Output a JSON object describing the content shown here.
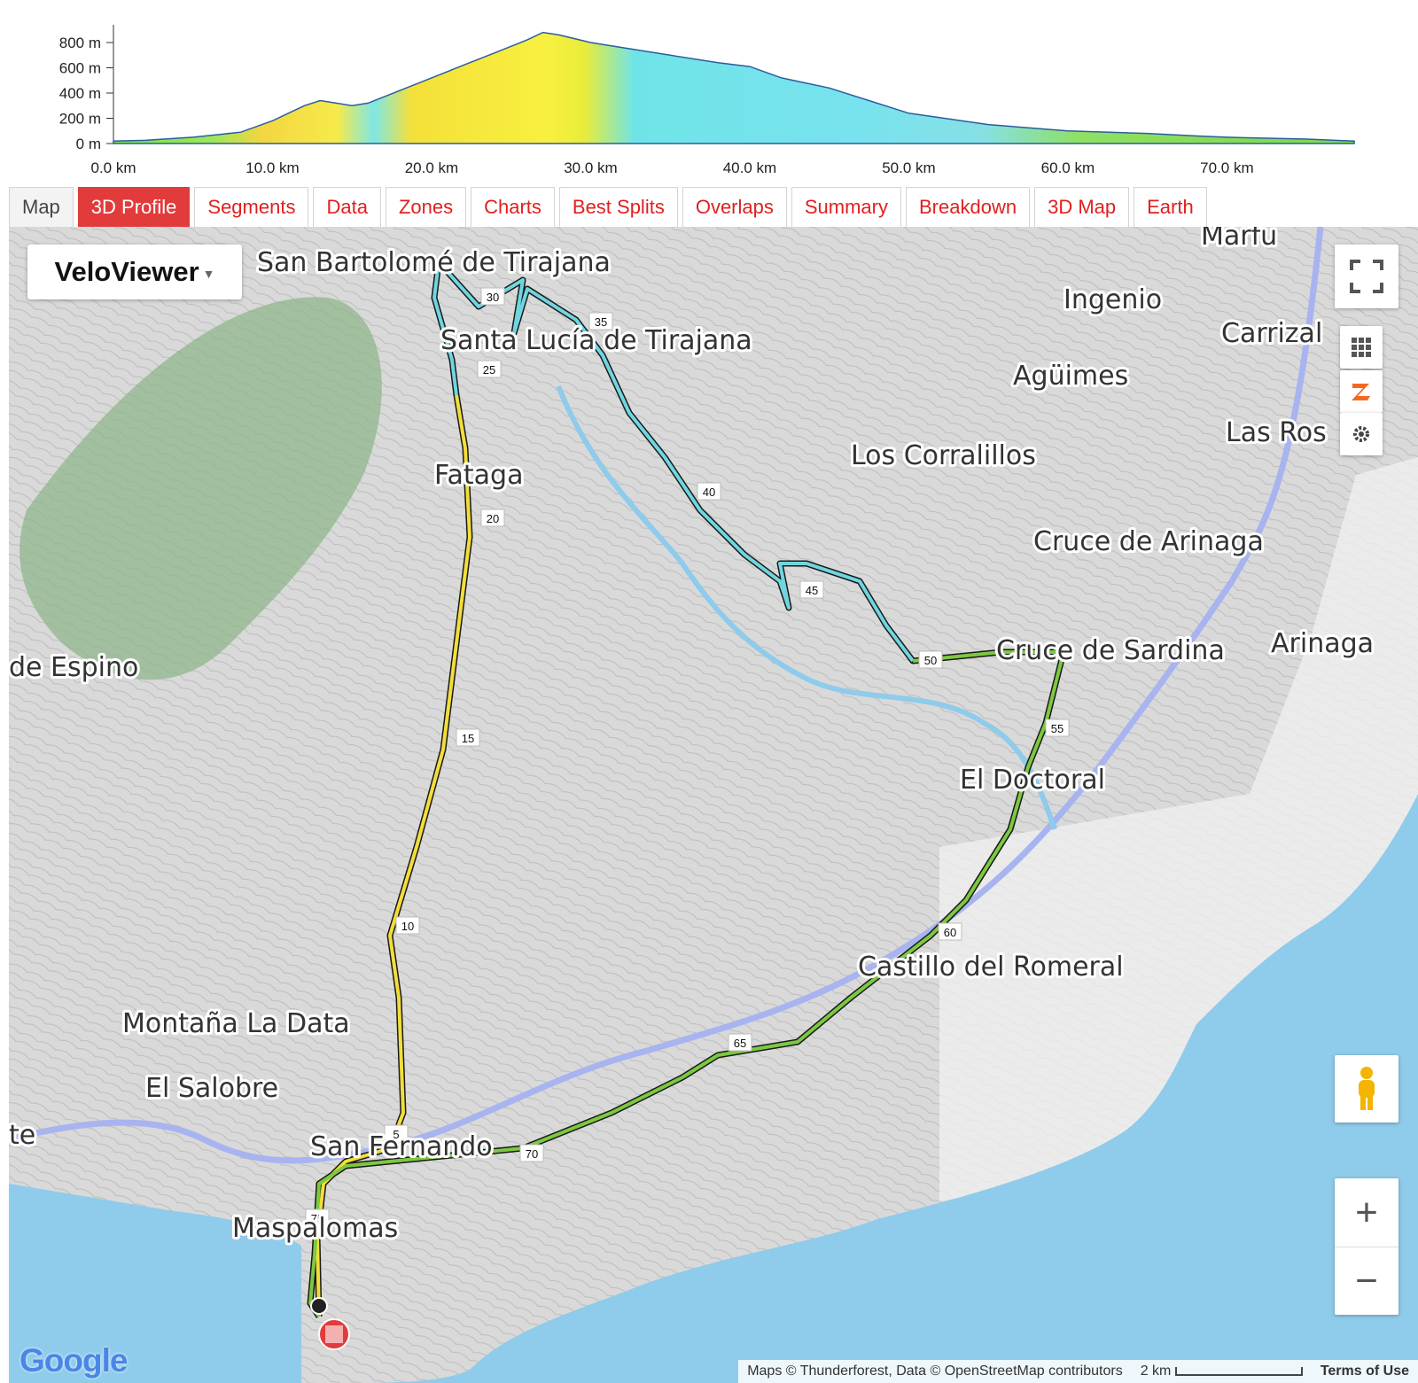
{
  "profile": {
    "y_ticks": [
      "800 m",
      "600 m",
      "400 m",
      "200 m",
      "0 m"
    ],
    "x_ticks": [
      "0.0 km",
      "10.0 km",
      "20.0 km",
      "30.0 km",
      "40.0 km",
      "50.0 km",
      "60.0 km",
      "70.0 km"
    ],
    "elevation_km": [
      0,
      2,
      5,
      8,
      10,
      12,
      13,
      14,
      15,
      16,
      18,
      20,
      22,
      24,
      26,
      27,
      28,
      30,
      32,
      35,
      38,
      40,
      42,
      45,
      48,
      50,
      55,
      60,
      65,
      68,
      70,
      75,
      78
    ],
    "elevation_m": [
      20,
      25,
      50,
      90,
      180,
      300,
      340,
      320,
      300,
      320,
      420,
      520,
      620,
      720,
      820,
      880,
      860,
      800,
      760,
      700,
      640,
      610,
      520,
      440,
      320,
      240,
      150,
      100,
      80,
      60,
      50,
      35,
      20
    ]
  },
  "tabs": [
    "Map",
    "3D Profile",
    "Segments",
    "Data",
    "Zones",
    "Charts",
    "Best Splits",
    "Overlaps",
    "Summary",
    "Breakdown",
    "3D Map",
    "Earth"
  ],
  "active_tab": "3D Profile",
  "map": {
    "type_label": "VeloViewer",
    "places": [
      {
        "name": "San Bartolomé de Tirajana"
      },
      {
        "name": "Santa Lucía de Tirajana"
      },
      {
        "name": "Marfu"
      },
      {
        "name": "Ingenio"
      },
      {
        "name": "Carrizal"
      },
      {
        "name": "Agüimes"
      },
      {
        "name": "Las Ros"
      },
      {
        "name": "Los Corralillos"
      },
      {
        "name": "Fataga"
      },
      {
        "name": "Cruce de Arinaga"
      },
      {
        "name": "Arinaga"
      },
      {
        "name": "Cruce de Sardina"
      },
      {
        "name": "de Espino"
      },
      {
        "name": "El Doctoral"
      },
      {
        "name": "Castillo del Romeral"
      },
      {
        "name": "Montaña La Data"
      },
      {
        "name": "El Salobre"
      },
      {
        "name": "San Fernando"
      },
      {
        "name": "te"
      },
      {
        "name": "Maspalomas"
      }
    ],
    "km_markers": [
      "5",
      "10",
      "15",
      "20",
      "25",
      "30",
      "35",
      "40",
      "45",
      "50",
      "55",
      "60",
      "65",
      "70",
      "75"
    ],
    "attribution": "Maps © Thunderforest, Data © OpenStreetMap contributors",
    "scale": "2 km",
    "terms": "Terms of Use",
    "google": "Google"
  },
  "colors": {
    "tab_red": "#e02020",
    "sea": "#8fcbea",
    "route_outline": "#1a1a1a"
  }
}
